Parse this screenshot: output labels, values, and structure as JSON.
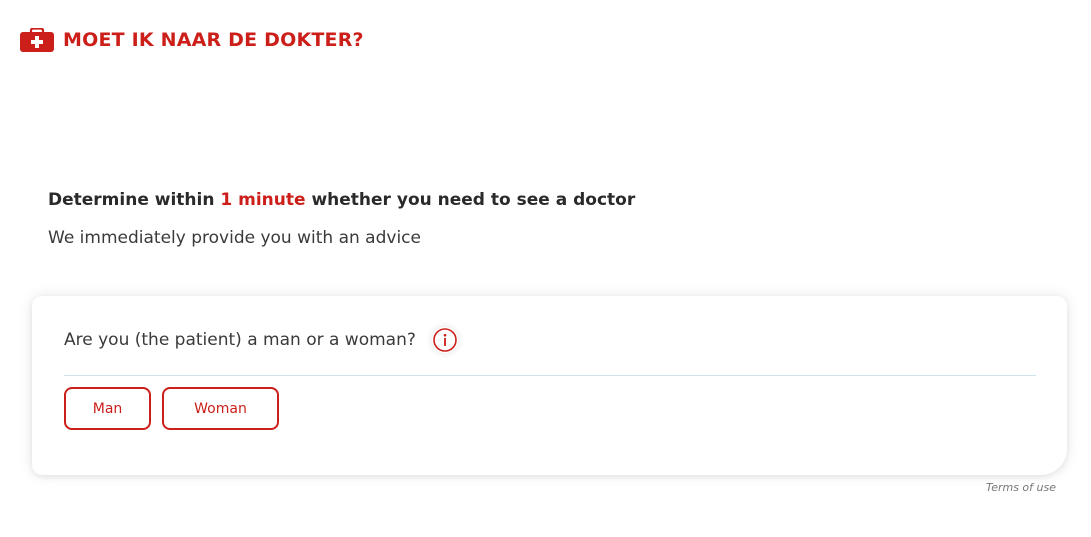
{
  "brand": {
    "logo_text": "MOET IK NAAR DE DOKTER?",
    "logo_icon": "first-aid-kit-icon",
    "accent_color": "#cc1f1a"
  },
  "intro": {
    "headline_before": "Determine within ",
    "headline_accent": "1 minute",
    "headline_after": " whether you need to see a doctor",
    "subline": "We immediately provide you with an advice"
  },
  "question_card": {
    "question": "Are you (the patient) a man or a woman?",
    "info_icon": "info-icon",
    "options": [
      {
        "label": "Man"
      },
      {
        "label": "Woman"
      }
    ]
  },
  "footer": {
    "terms_link": "Terms of use"
  }
}
